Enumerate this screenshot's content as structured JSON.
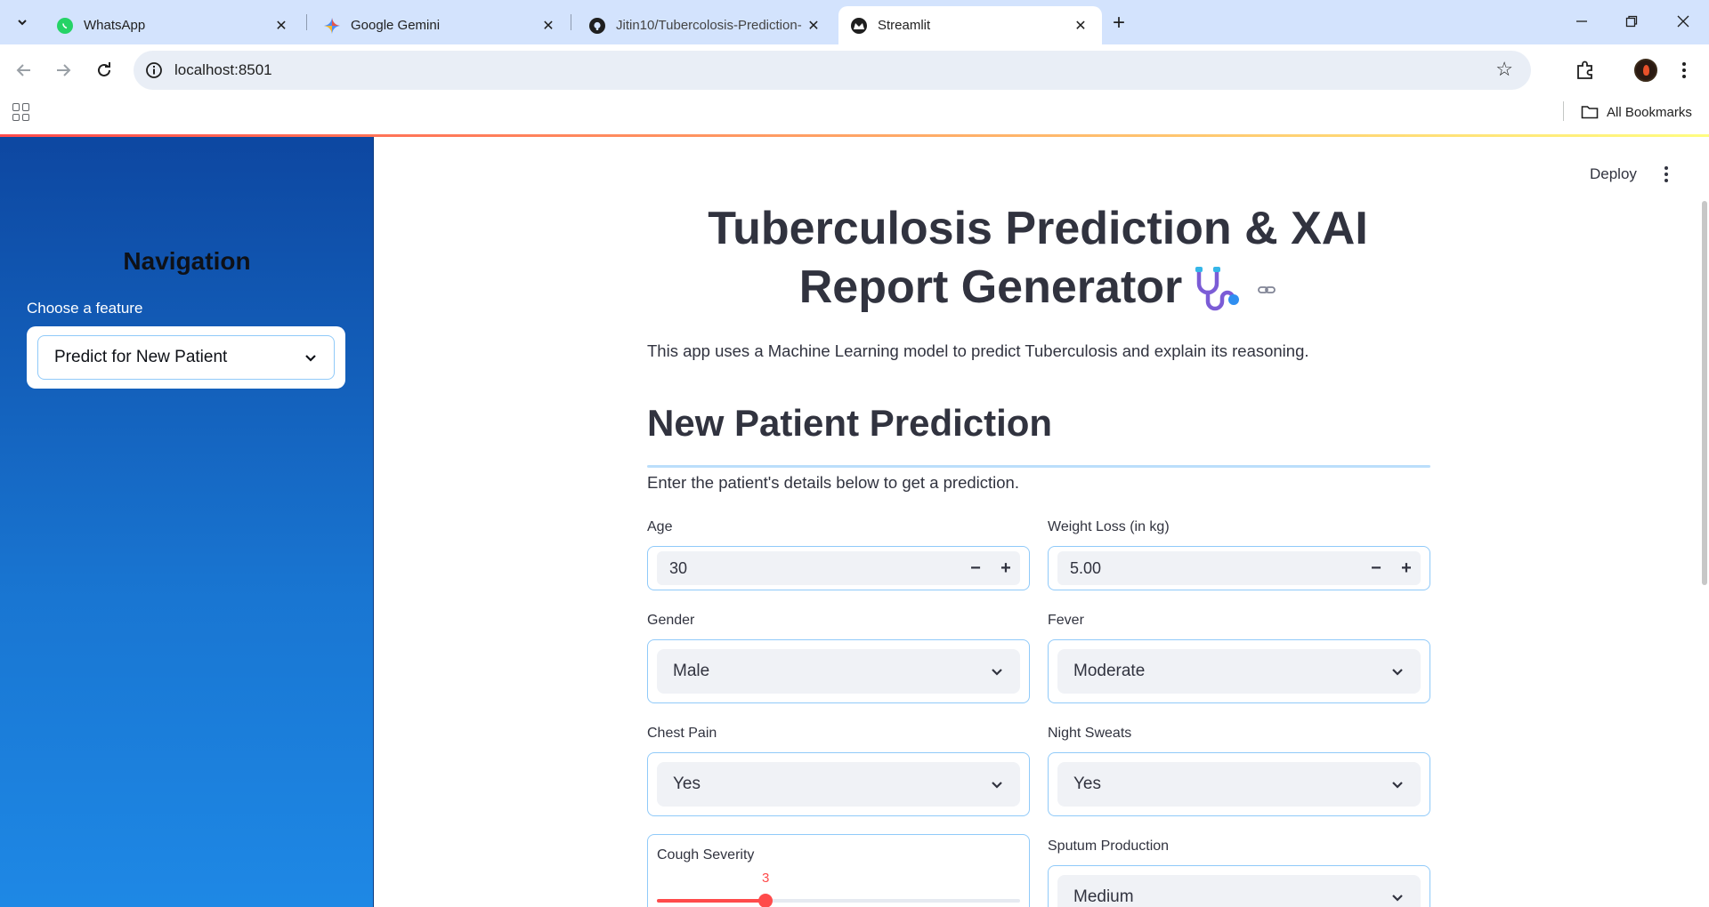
{
  "browser": {
    "tabs": [
      {
        "title": "WhatsApp",
        "favicon": "whatsapp-icon",
        "active": false
      },
      {
        "title": "Google Gemini",
        "favicon": "gemini-icon",
        "active": false
      },
      {
        "title": "Jitin10/Tubercolosis-Prediction-",
        "favicon": "github-icon",
        "active": false
      },
      {
        "title": "Streamlit",
        "favicon": "streamlit-icon",
        "active": true
      }
    ],
    "url": "localhost:8501",
    "bookmarks_label": "All Bookmarks"
  },
  "sidebar": {
    "title": "Navigation",
    "select_label": "Choose a feature",
    "select_value": "Predict for New Patient",
    "gradient": [
      "#0d47a1",
      "#1e88e5"
    ]
  },
  "header": {
    "deploy_label": "Deploy"
  },
  "main": {
    "title_line1": "Tuberculosis Prediction & XAI",
    "title_line2": "Report Generator",
    "title_icon": "stethoscope-icon",
    "intro": "This app uses a Machine Learning model to predict Tuberculosis and explain its reasoning.",
    "section_heading": "New Patient Prediction",
    "section_sub": "Enter the patient's details below to get a prediction.",
    "fields": {
      "age": {
        "label": "Age",
        "value": "30"
      },
      "weight_loss": {
        "label": "Weight Loss (in kg)",
        "value": "5.00"
      },
      "gender": {
        "label": "Gender",
        "value": "Male"
      },
      "fever": {
        "label": "Fever",
        "value": "Moderate"
      },
      "chest_pain": {
        "label": "Chest Pain",
        "value": "Yes"
      },
      "night_sweats": {
        "label": "Night Sweats",
        "value": "Yes"
      },
      "cough_severity": {
        "label": "Cough Severity",
        "value": "3",
        "fraction": 0.3
      },
      "sputum_production": {
        "label": "Sputum Production",
        "value": "Medium"
      }
    },
    "accent_color": "#ff4b4b"
  }
}
